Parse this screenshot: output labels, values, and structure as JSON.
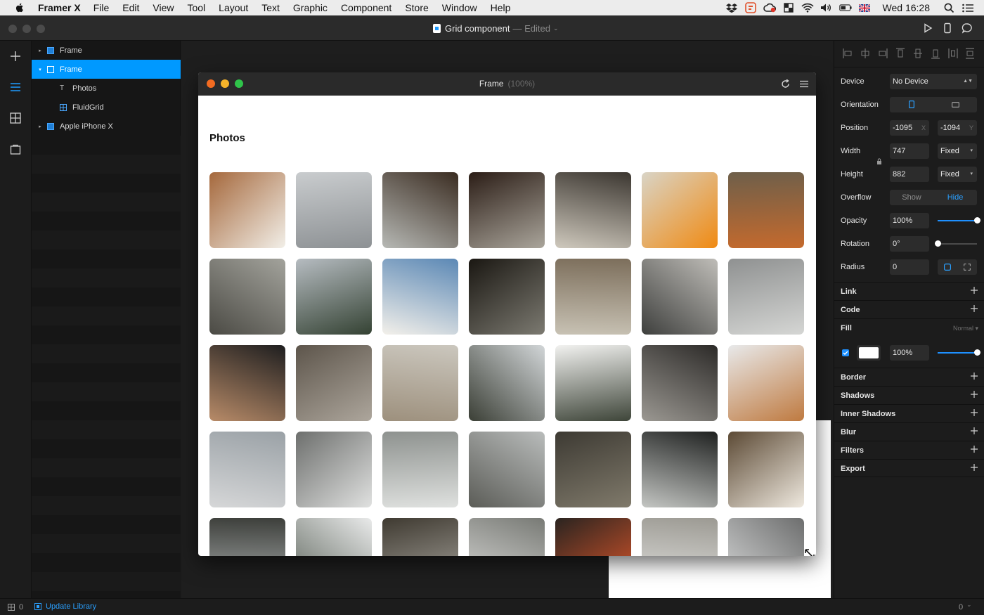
{
  "menubar": {
    "app_name": "Framer X",
    "items": [
      "File",
      "Edit",
      "View",
      "Tool",
      "Layout",
      "Text",
      "Graphic",
      "Component",
      "Store",
      "Window",
      "Help"
    ],
    "clock": "Wed 16:28"
  },
  "titlebar": {
    "doc_name": "Grid component",
    "status": "— Edited"
  },
  "layers": [
    {
      "label": "Frame",
      "depth": 0,
      "caret": "▸",
      "icon": "frame-icon",
      "selected": false
    },
    {
      "label": "Frame",
      "depth": 0,
      "caret": "▾",
      "icon": "frame-icon",
      "selected": true
    },
    {
      "label": "Photos",
      "depth": 1,
      "caret": "",
      "icon": "text-icon",
      "selected": false
    },
    {
      "label": "FluidGrid",
      "depth": 1,
      "caret": "",
      "icon": "grid-component-icon",
      "selected": false
    },
    {
      "label": "Apple iPhone X",
      "depth": 0,
      "caret": "▸",
      "icon": "frame-icon",
      "selected": false
    }
  ],
  "preview": {
    "title": "Frame",
    "zoom": "(100%)",
    "heading": "Photos"
  },
  "photos": [
    [
      "#a5683c",
      "#f2efe8"
    ],
    [
      "#c9ccce",
      "#8d9194"
    ],
    [
      "#3a2c21",
      "#b7b9b5"
    ],
    [
      "#2b1d16",
      "#aaa59b"
    ],
    [
      "#3b3630",
      "#cfc9bd"
    ],
    [
      "#d9d4c6",
      "#f08a12"
    ],
    [
      "#6e5f4a",
      "#c56a2d"
    ],
    [
      "#a3a39c",
      "#4b4a44"
    ],
    [
      "#b6bcc1",
      "#344233"
    ],
    [
      "#5b88b5",
      "#f3f0ea"
    ],
    [
      "#1a1712",
      "#7c7a71"
    ],
    [
      "#7c6e5b",
      "#c8c2b4"
    ],
    [
      "#bfbdb8",
      "#3e3f3d"
    ],
    [
      "#8f9191",
      "#d5d6d4"
    ],
    [
      "#1e1e1f",
      "#b88b68"
    ],
    [
      "#5d554b",
      "#ada69c"
    ],
    [
      "#cbc7be",
      "#9d907d"
    ],
    [
      "#d2d6d8",
      "#3b3f36"
    ],
    [
      "#f2f2f0",
      "#3e4539"
    ],
    [
      "#2c2a28",
      "#9b9892"
    ],
    [
      "#e8e9ea",
      "#bf7a40"
    ],
    [
      "#9aa1a6",
      "#d6d7d8"
    ],
    [
      "#6d6f6d",
      "#e0e1e0"
    ],
    [
      "#8e928f",
      "#dfe1df"
    ],
    [
      "#b9bcbb",
      "#5b5c57"
    ],
    [
      "#3d3a33",
      "#807a6b"
    ],
    [
      "#1f2120",
      "#c4c6c3"
    ],
    [
      "#5c4a35",
      "#efe9df"
    ],
    [
      "#3d3f3b",
      "#aeb2b2"
    ],
    [
      "#e9eaea",
      "#5e665d"
    ],
    [
      "#3f3a31",
      "#aaa7a0"
    ],
    [
      "#787a75",
      "#dcdcda"
    ],
    [
      "#2a2420",
      "#e0572a"
    ],
    [
      "#9c9a93",
      "#e5e5e3"
    ],
    [
      "#6d6e6e",
      "#d7d8d8"
    ]
  ],
  "properties": {
    "device": {
      "label": "Device",
      "value": "No Device"
    },
    "orientation": {
      "label": "Orientation"
    },
    "position": {
      "label": "Position",
      "x": "-1095",
      "x_suffix": "X",
      "y": "-1094",
      "y_suffix": "Y"
    },
    "width": {
      "label": "Width",
      "value": "747",
      "mode": "Fixed"
    },
    "height": {
      "label": "Height",
      "value": "882",
      "mode": "Fixed"
    },
    "overflow": {
      "label": "Overflow",
      "options": [
        "Show",
        "Hide"
      ],
      "selected": "Hide"
    },
    "opacity": {
      "label": "Opacity",
      "value": "100%",
      "level": 1.0
    },
    "rotation": {
      "label": "Rotation",
      "value": "0°",
      "level": 0.0
    },
    "radius": {
      "label": "Radius",
      "value": "0"
    },
    "fill": {
      "label": "Fill",
      "blend": "Normal ▾",
      "color": "#ffffff",
      "opacity": "100%",
      "level": 1.0,
      "enabled": true
    },
    "sections": [
      "Link",
      "Code",
      "Border",
      "Shadows",
      "Inner Shadows",
      "Blur",
      "Filters",
      "Export"
    ]
  },
  "status": {
    "left_count": "0",
    "update_library": "Update Library",
    "right_count": "0"
  },
  "colors": {
    "accent": "#0099ff",
    "traffic_red": "#f26b21",
    "traffic_yellow": "#f5b32a",
    "traffic_green": "#2fc44a"
  }
}
